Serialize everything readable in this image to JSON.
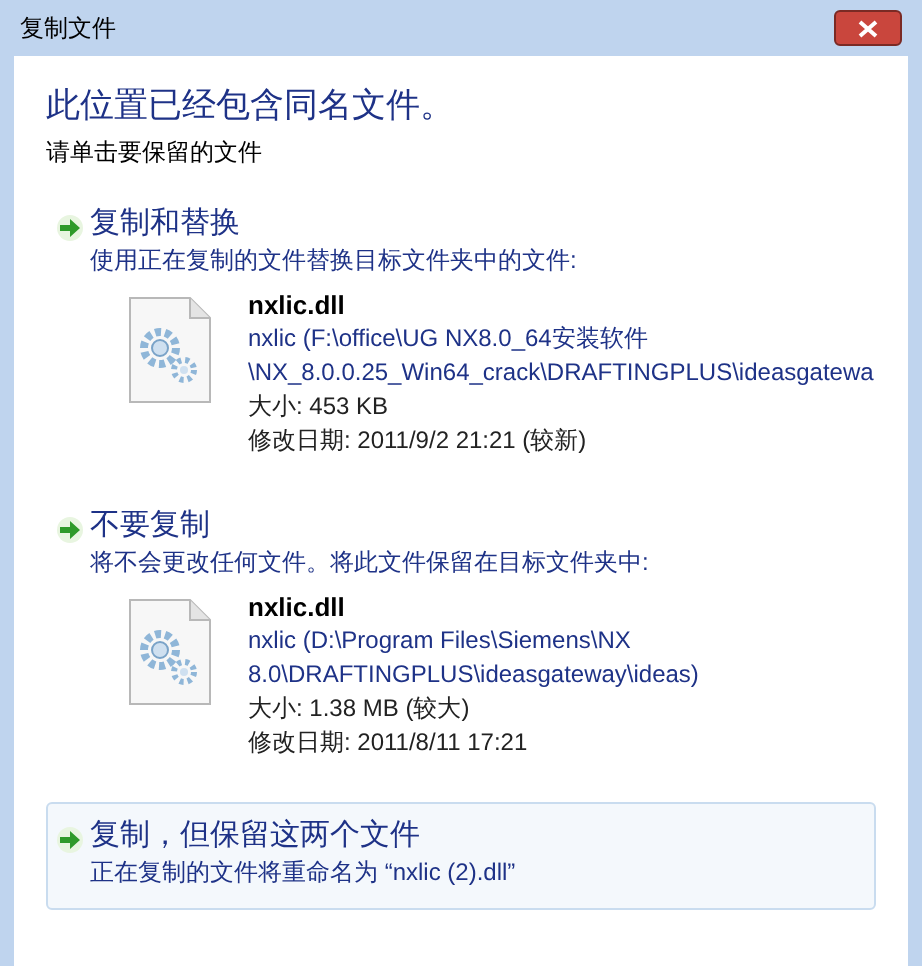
{
  "window": {
    "title": "复制文件"
  },
  "heading": "此位置已经包含同名文件。",
  "instruction": "请单击要保留的文件",
  "options": [
    {
      "title": "复制和替换",
      "description": "使用正在复制的文件替换目标文件夹中的文件:",
      "selected": false,
      "file": {
        "name": "nxlic.dll",
        "location_lines": [
          "nxlic (F:\\office\\UG NX8.0_64安装软件",
          "\\NX_8.0.0.25_Win64_crack\\DRAFTINGPLUS\\ideasgatewa"
        ],
        "size": "大小: 453 KB",
        "modified": "修改日期: 2011/9/2 21:21 (较新)"
      }
    },
    {
      "title": "不要复制",
      "description": "将不会更改任何文件。将此文件保留在目标文件夹中:",
      "selected": false,
      "file": {
        "name": "nxlic.dll",
        "location_lines": [
          "nxlic (D:\\Program Files\\Siemens\\NX",
          "8.0\\DRAFTINGPLUS\\ideasgateway\\ideas)"
        ],
        "size": "大小: 1.38 MB (较大)",
        "modified": "修改日期: 2011/8/11 17:21"
      }
    },
    {
      "title": "复制，但保留这两个文件",
      "description": "正在复制的文件将重命名为 “nxlic (2).dll”",
      "selected": true
    }
  ]
}
